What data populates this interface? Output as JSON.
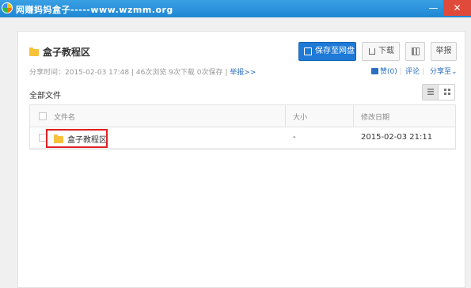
{
  "window": {
    "title": "网赚妈妈盒子-----www.wzmm.org",
    "minimize": "—",
    "close": "✕"
  },
  "share": {
    "title": "盒子教程区",
    "meta_text": "分享时间：2015-02-03 17:48 | 46次浏览 9次下载 0次保存 | ",
    "report_link": "举报>>"
  },
  "buttons": {
    "save": "保存至网盘",
    "download": "下载",
    "report": "举报"
  },
  "actions": {
    "like": "赞(0)",
    "comment": "评论",
    "share": "分享至"
  },
  "file_list": {
    "label": "全部文件",
    "columns": {
      "name": "文件名",
      "size": "大小",
      "date": "修改日期"
    },
    "rows": [
      {
        "name": "盒子教程区",
        "size": "-",
        "date": "2015-02-03 21:11"
      }
    ]
  },
  "icons": [
    "app-logo-icon",
    "folder-icon",
    "save-icon",
    "download-icon",
    "qr-code-icon",
    "thumbs-up-icon",
    "list-view-icon",
    "grid-view-icon",
    "checkbox-icon"
  ],
  "colors": {
    "titlebar": "#1f86d2",
    "accent": "#1e7ad6",
    "link": "#2b6fbf",
    "highlight": "#e02020",
    "folder": "#f7c13a"
  }
}
